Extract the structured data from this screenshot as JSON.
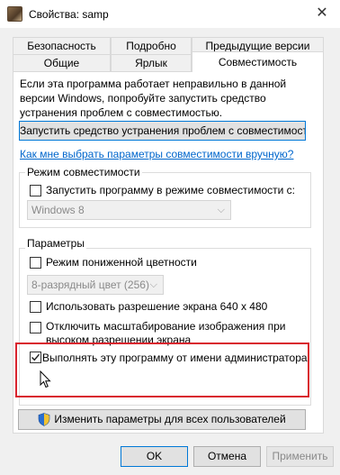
{
  "window": {
    "title": "Свойства: samp",
    "app_icon": "samp-app-icon",
    "close_glyph": "✕"
  },
  "tabs": {
    "row1": [
      "Безопасность",
      "Подробно",
      "Предыдущие версии"
    ],
    "row2": [
      "Общие",
      "Ярлык",
      "Совместимость"
    ],
    "active": "Совместимость"
  },
  "intro_text": "Если эта программа работает неправильно в данной версии Windows, попробуйте запустить средство устранения проблем с совместимостью.",
  "troubleshooter_button": "Запустить средство устранения проблем с совместимостью",
  "help_link": "Как мне выбрать параметры совместимости вручную?",
  "compat_mode": {
    "group_label": "Режим совместимости",
    "checkbox_label": "Запустить программу в режиме совместимости с:",
    "checked": false,
    "os_selected": "Windows 8"
  },
  "settings": {
    "group_label": "Параметры",
    "reduced_color": {
      "label": "Режим пониженной цветности",
      "checked": false
    },
    "color_selected": "8-разрядный цвет (256)",
    "res_640": {
      "label": "Использовать разрешение экрана 640 x 480",
      "checked": false
    },
    "dpi_scaling": {
      "label_line1": "Отключить масштабирование изображения при",
      "label_line2": "высоком разрешении экрана",
      "checked": false
    },
    "run_as_admin": {
      "label": "Выполнять эту программу от имени администратора",
      "checked": true
    }
  },
  "all_users_button": "Изменить параметры для всех пользователей",
  "footer": {
    "ok": "OK",
    "cancel": "Отмена",
    "apply": "Применить"
  },
  "colors": {
    "highlight_border": "#d9232e",
    "link": "#0066cc",
    "focus_border": "#0078d7",
    "dialog_bg": "#f0f0f0"
  }
}
